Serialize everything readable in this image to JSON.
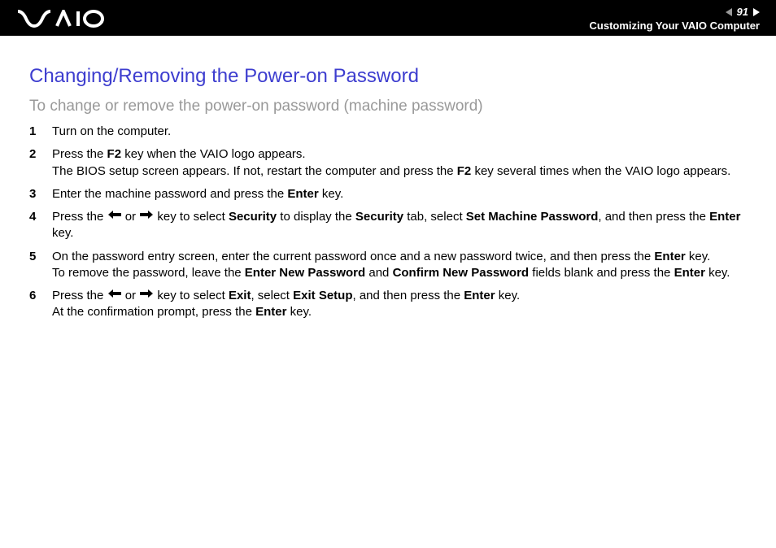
{
  "header": {
    "page_number": "91",
    "breadcrumb": "Customizing Your VAIO Computer"
  },
  "page": {
    "title": "Changing/Removing the Power-on Password",
    "subtitle": "To change or remove the power-on password (machine password)"
  },
  "steps": {
    "s1": {
      "num": "1",
      "text": "Turn on the computer."
    },
    "s2": {
      "num": "2",
      "pre": "Press the ",
      "k1": "F2",
      "mid1": " key when the VAIO logo appears.",
      "line2a": "The BIOS setup screen appears. If not, restart the computer and press the ",
      "k2": "F2",
      "line2b": " key several times when the VAIO logo appears."
    },
    "s3": {
      "num": "3",
      "pre": "Enter the machine password and press the ",
      "k1": "Enter",
      "post": " key."
    },
    "s4": {
      "num": "4",
      "pre": "Press the ",
      "or": " or ",
      "mid1": " key to select ",
      "k_sec1": "Security",
      "mid2": " to display the ",
      "k_sec2": "Security",
      "mid3": " tab, select ",
      "k_smp": "Set Machine Password",
      "mid4": ", and then press the ",
      "k_enter": "Enter",
      "post": " key."
    },
    "s5": {
      "num": "5",
      "pre": "On the password entry screen, enter the current password once and a new password twice, and then press the ",
      "k1": "Enter",
      "mid1": " key.",
      "line2a": "To remove the password, leave the ",
      "k_enp": "Enter New Password",
      "line2b": " and ",
      "k_cnp": "Confirm New Password",
      "line2c": " fields blank and press the ",
      "k2": "Enter",
      "line2d": " key."
    },
    "s6": {
      "num": "6",
      "pre": "Press the ",
      "or": " or ",
      "mid1": " key to select ",
      "k_exit1": "Exit",
      "mid2": ", select ",
      "k_exit2": "Exit Setup",
      "mid3": ", and then press the ",
      "k_enter": "Enter",
      "mid4": " key.",
      "line2a": "At the confirmation prompt, press the ",
      "k_enter2": "Enter",
      "line2b": " key."
    }
  }
}
